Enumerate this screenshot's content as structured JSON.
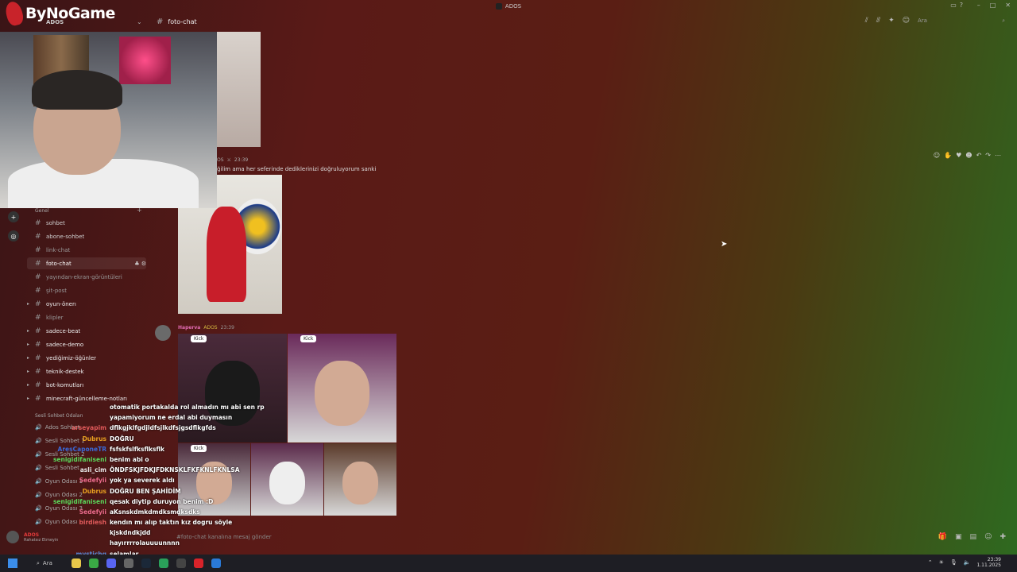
{
  "window": {
    "title": "ADOS"
  },
  "stream": {
    "logo_text": "ByNoGame"
  },
  "server": {
    "name": "ADOS"
  },
  "header": {
    "channel": "foto-chat",
    "search_placeholder": "Ara"
  },
  "messages": {
    "m1": {
      "role": "OS",
      "time": "23:39",
      "text": "ğilim ama her seferinde dediklerinizi doğruluyorum sanki"
    },
    "m2": {
      "author": "Haperva",
      "role": "ADOS",
      "time": "23:39",
      "kick_label": "Kick"
    }
  },
  "sidebar": {
    "category": "Genel",
    "channels": [
      {
        "name": "sohbet"
      },
      {
        "name": "abone-sohbet"
      },
      {
        "name": "link-chat"
      },
      {
        "name": "foto-chat"
      },
      {
        "name": "yayından-ekran-görüntüleri"
      },
      {
        "name": "şit-post"
      },
      {
        "name": "oyun-önerı"
      },
      {
        "name": "klipler"
      },
      {
        "name": "sadece-beat"
      },
      {
        "name": "sadece-demo"
      },
      {
        "name": "yediğimiz-öğünler"
      },
      {
        "name": "teknik-destek"
      },
      {
        "name": "bot-komutları"
      },
      {
        "name": "minecraft-güncelleme-notları"
      }
    ],
    "voice_category": "Sesli Sohbet Odaları",
    "voice_channels": [
      {
        "name": "Ados Sohbet"
      },
      {
        "name": "Sesli Sohbet 1"
      },
      {
        "name": "Sesli Sohbet 2"
      },
      {
        "name": "Sesli Sohbet"
      },
      {
        "name": "Oyun Odası 1"
      },
      {
        "name": "Oyun Odası 2"
      },
      {
        "name": "Oyun Odası 3"
      },
      {
        "name": "Oyun Odası"
      }
    ]
  },
  "chat_overlay": [
    {
      "user": "",
      "color": "#c84444",
      "text": "otomatik portakalda rol almadın mı abi sen rp"
    },
    {
      "user": "",
      "color": "#c84444",
      "text": "yapamiyorum ne erdal abi duymasın"
    },
    {
      "user": "arseyapim",
      "color": "#e05a5a",
      "text": "dflkgjklfgdjldfsjlkdfsjgsdflkgfds"
    },
    {
      "user": "Dubrus",
      "color": "#e8a020",
      "text": "DOĞRU"
    },
    {
      "user": "AresCaponeTR",
      "color": "#3a6ad8",
      "text": "fsfskfslfksflksflk"
    },
    {
      "user": "senigidifaniseni",
      "color": "#5ad85a",
      "text": "benim abi o"
    },
    {
      "user": "asli_cim",
      "color": "#e8e8e8",
      "text": "ÖNDFSKJFDKJFDKNSKLFKFKNLFKNLSA"
    },
    {
      "user": "Sedefyii",
      "color": "#e86a8a",
      "text": "yok ya severek aldı"
    },
    {
      "user": "Dubrus",
      "color": "#e8a020",
      "text": "DOĞRU BEN ŞAHİDİM"
    },
    {
      "user": "senigidifaniseni",
      "color": "#5ad85a",
      "text": "qesak diytip duruyon benim :D"
    },
    {
      "user": "Sedefyii",
      "color": "#e86a8a",
      "text": "aKsnskdmkdmdksmdksdks"
    },
    {
      "user": "birdiesh",
      "color": "#e05a5a",
      "text": "kendın mı alıp taktın kız dogru söyle"
    },
    {
      "user": "",
      "color": "#c84444",
      "text": "kjskdndkjdd"
    },
    {
      "user": "",
      "color": "#c84444",
      "text": "hayırrrrolauuuunnnn"
    },
    {
      "user": "mystichg",
      "color": "#5a8ad8",
      "text": "selamlar"
    }
  ],
  "composer": {
    "placeholder": "#foto-chat kanalına mesaj gönder"
  },
  "user_panel": {
    "name": "ADOS",
    "status": "Rahatsız Etmeyin"
  },
  "taskbar": {
    "search": "Ara",
    "time": "23:39",
    "date": "1.11.2025"
  },
  "colors": {
    "accent": "#e06ab0",
    "brand": "#c8232a"
  }
}
